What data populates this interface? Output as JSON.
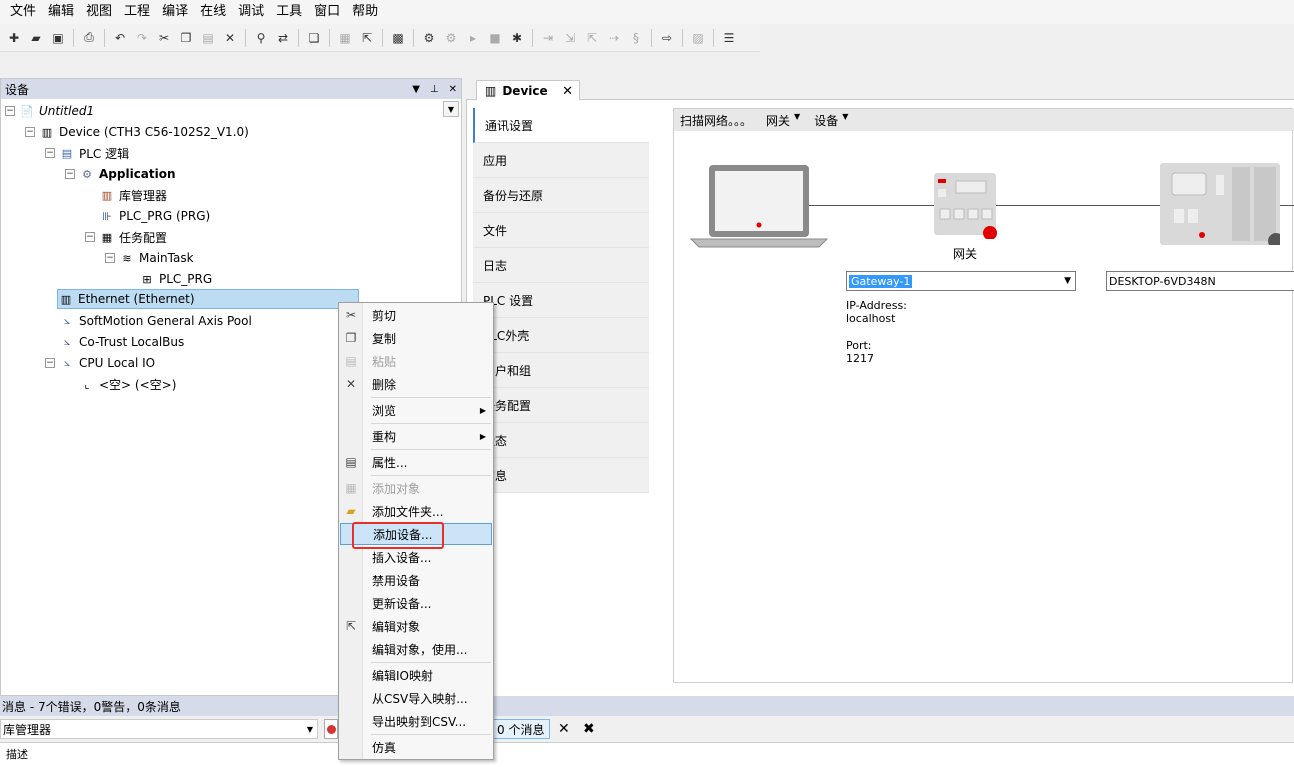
{
  "menubar": [
    "文件",
    "编辑",
    "视图",
    "工程",
    "编译",
    "在线",
    "调试",
    "工具",
    "窗口",
    "帮助"
  ],
  "left_panel": {
    "title": "设备",
    "tree": [
      {
        "label": "Untitled1",
        "icon": "project-icon"
      },
      {
        "label": "Device (CTH3 C56-102S2_V1.0)",
        "icon": "device-icon"
      },
      {
        "label": "PLC 逻辑",
        "icon": "plc-logic-icon"
      },
      {
        "label": "Application",
        "icon": "application-gear-icon"
      },
      {
        "label": "库管理器",
        "icon": "library-icon"
      },
      {
        "label": "PLC_PRG (PRG)",
        "icon": "program-icon"
      },
      {
        "label": "任务配置",
        "icon": "task-config-icon"
      },
      {
        "label": "MainTask",
        "icon": "task-icon"
      },
      {
        "label": "PLC_PRG",
        "icon": "program-call-icon"
      },
      {
        "label": "Ethernet (Ethernet)",
        "icon": "ethernet-icon"
      },
      {
        "label": "SoftMotion General Axis Pool",
        "icon": "axis-pool-icon"
      },
      {
        "label": "Co-Trust LocalBus",
        "icon": "bus-icon"
      },
      {
        "label": "CPU Local IO",
        "icon": "io-icon"
      },
      {
        "label": "<空> (<空>)",
        "icon": "empty-slot-icon"
      }
    ]
  },
  "editor": {
    "tab_label": "Device",
    "side_tabs": [
      "通讯设置",
      "应用",
      "备份与还原",
      "文件",
      "日志",
      "PLC 设置",
      "PLC外壳",
      "用户和组",
      "任务配置",
      "状态",
      "信息"
    ],
    "content_toolbar": {
      "scan": "扫描网络。。。",
      "gateway": "网关",
      "device": "设备"
    },
    "gateway_label": "网关",
    "gateway_select": "Gateway-1",
    "device_field": "DESKTOP-6VD348N",
    "gateway_info": {
      "ip_label": "IP-Address:",
      "ip_value": "localhost",
      "port_label": "Port:",
      "port_value": "1217"
    },
    "status_colors": {
      "gateway": "#e00000",
      "device": "#555555"
    }
  },
  "context_menu": {
    "items": [
      {
        "label": "剪切",
        "icon": "cut-icon",
        "disabled": false
      },
      {
        "label": "复制",
        "icon": "copy-icon",
        "disabled": false
      },
      {
        "label": "粘贴",
        "icon": "paste-icon",
        "disabled": true
      },
      {
        "label": "删除",
        "icon": "delete-icon",
        "disabled": false
      },
      {
        "label": "浏览",
        "icon": "",
        "disabled": false,
        "submenu": true
      },
      {
        "label": "重构",
        "icon": "",
        "disabled": false,
        "submenu": true
      },
      {
        "label": "属性...",
        "icon": "properties-icon",
        "disabled": false
      },
      {
        "label": "添加对象",
        "icon": "add-object-icon",
        "disabled": true
      },
      {
        "label": "添加文件夹...",
        "icon": "folder-icon",
        "disabled": false
      },
      {
        "label": "添加设备...",
        "icon": "",
        "disabled": false,
        "highlighted": true
      },
      {
        "label": "插入设备...",
        "icon": "",
        "disabled": false
      },
      {
        "label": "禁用设备",
        "icon": "",
        "disabled": false
      },
      {
        "label": "更新设备...",
        "icon": "",
        "disabled": false
      },
      {
        "label": "编辑对象",
        "icon": "edit-object-icon",
        "disabled": false
      },
      {
        "label": "编辑对象，使用...",
        "icon": "",
        "disabled": false
      },
      {
        "label": "编辑IO映射",
        "icon": "",
        "disabled": false
      },
      {
        "label": "从CSV导入映射...",
        "icon": "",
        "disabled": false
      },
      {
        "label": "导出映射到CSV...",
        "icon": "",
        "disabled": false
      },
      {
        "label": "仿真",
        "icon": "",
        "disabled": false
      }
    ],
    "highlight_color": "#e8302a"
  },
  "messages": {
    "header": "消息 - 7个错误，0警告，0条消息",
    "source": "库管理器",
    "messages_count": "0 个消息",
    "description_header": "描述"
  }
}
